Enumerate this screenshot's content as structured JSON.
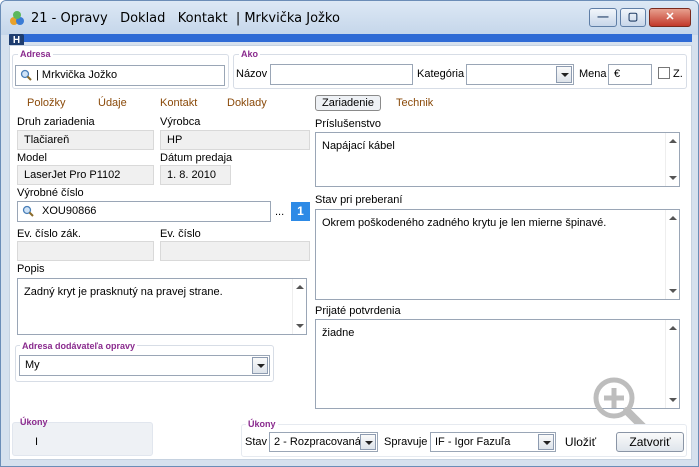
{
  "window": {
    "title": "21 - Opravy   Doklad   Kontakt  | Mrkvička Jožko",
    "minimize": "—",
    "maximize": "▢",
    "close": "✕",
    "badge": "H"
  },
  "adresa": {
    "group_label": "Adresa",
    "value": "| Mrkvička Jožko"
  },
  "ako": {
    "group_label": "Ako",
    "nazov_label": "Názov",
    "nazov_value": "",
    "kategoria_label": "Kategória",
    "kategoria_value": "",
    "mena_label": "Mena",
    "mena_value": "€",
    "z_label": "Z."
  },
  "tabs": [
    {
      "label": "Položky"
    },
    {
      "label": "Údaje"
    },
    {
      "label": "Kontakt"
    },
    {
      "label": "Doklady"
    },
    {
      "label": "Zariadenie"
    },
    {
      "label": "Technik"
    }
  ],
  "form": {
    "druh_label": "Druh zariadenia",
    "druh_value": "Tlačiareň",
    "vyrobca_label": "Výrobca",
    "vyrobca_value": "HP",
    "model_label": "Model",
    "model_value": "LaserJet Pro P1102",
    "datum_label": "Dátum predaja",
    "datum_value": "1. 8. 2010",
    "vyrobne_label": "Výrobné číslo",
    "vyrobne_value": "XOU90866",
    "ellipsis": "...",
    "count_badge": "1",
    "ev_zak_label": "Ev. číslo zák.",
    "ev_zak_value": "",
    "ev_label": "Ev. číslo",
    "ev_value": "",
    "popis_label": "Popis",
    "popis_value": "Zadný kryt je prasknutý na pravej strane.",
    "adresa_dod_label": "Adresa dodávateľa opravy",
    "adresa_dod_value": "My"
  },
  "right": {
    "prislusenstvo_label": "Príslušenstvo",
    "prislusenstvo_value": "Napájací kábel",
    "stav_label": "Stav pri preberaní",
    "stav_value": "Okrem poškodeného zadného krytu je len mierne špinavé.",
    "potvrdenia_label": "Prijaté potvrdenia",
    "potvrdenia_value": "žiadne"
  },
  "footer": {
    "ukony_left_label": "Úkony",
    "ukony_left_value": "I",
    "ukony_label": "Úkony",
    "stav_label": "Stav",
    "stav_value": "2 - Rozpracovaná",
    "spravuje_label": "Spravuje",
    "spravuje_value": "IF - Igor Fazuľa",
    "ulozit": "Uložiť",
    "zatvorit": "Zatvoriť"
  }
}
